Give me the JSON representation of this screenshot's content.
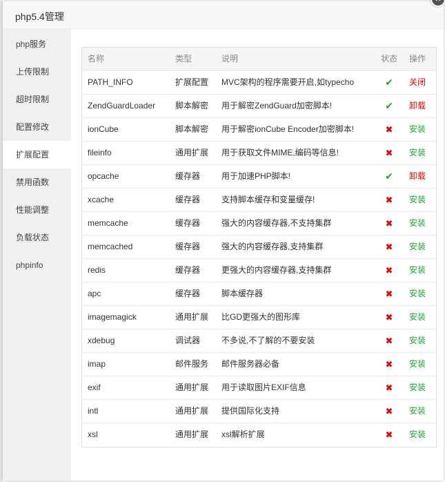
{
  "dialog": {
    "title": "php5.4管理",
    "close_icon": "×"
  },
  "sidebar": {
    "items": [
      {
        "label": "php服务"
      },
      {
        "label": "上传限制"
      },
      {
        "label": "超时限制"
      },
      {
        "label": "配置修改"
      },
      {
        "label": "扩展配置",
        "active": true
      },
      {
        "label": "禁用函数"
      },
      {
        "label": "性能调整"
      },
      {
        "label": "负载状态"
      },
      {
        "label": "phpinfo"
      }
    ]
  },
  "table": {
    "headers": {
      "name": "名称",
      "type": "类型",
      "desc": "说明",
      "status": "状态",
      "op": "操作"
    },
    "rows": [
      {
        "name": "PATH_INFO",
        "type": "扩展配置",
        "desc": "MVC架构的程序需要开启,如typecho",
        "status": "✔",
        "op": "关闭"
      },
      {
        "name": "ZendGuardLoader",
        "type": "脚本解密",
        "desc": "用于解密ZendGuard加密脚本!",
        "status": "✔",
        "op": "卸载"
      },
      {
        "name": "ionCube",
        "type": "脚本解密",
        "desc": "用于解密ionCube Encoder加密脚本!",
        "status": "✖",
        "op": "安装"
      },
      {
        "name": "fileinfo",
        "type": "通用扩展",
        "desc": "用于获取文件MIME,编码等信息!",
        "status": "✖",
        "op": "安装"
      },
      {
        "name": "opcache",
        "type": "缓存器",
        "desc": "用于加速PHP脚本!",
        "status": "✔",
        "op": "卸载"
      },
      {
        "name": "xcache",
        "type": "缓存器",
        "desc": "支持脚本缓存和变量缓存!",
        "status": "✖",
        "op": "安装"
      },
      {
        "name": "memcache",
        "type": "缓存器",
        "desc": "强大的内容缓存器,不支持集群",
        "status": "✖",
        "op": "安装"
      },
      {
        "name": "memcached",
        "type": "缓存器",
        "desc": "强大的内容缓存器,支持集群",
        "status": "✖",
        "op": "安装"
      },
      {
        "name": "redis",
        "type": "缓存器",
        "desc": "更强大的内容缓存器,支持集群",
        "status": "✖",
        "op": "安装"
      },
      {
        "name": "apc",
        "type": "缓存器",
        "desc": "脚本缓存器",
        "status": "✖",
        "op": "安装"
      },
      {
        "name": "imagemagick",
        "type": "通用扩展",
        "desc": "比GD更强大的图形库",
        "status": "✖",
        "op": "安装"
      },
      {
        "name": "xdebug",
        "type": "调试器",
        "desc": "不多说,不了解的不要安装",
        "status": "✖",
        "op": "安装"
      },
      {
        "name": "imap",
        "type": "邮件服务",
        "desc": "邮件服务器必备",
        "status": "✖",
        "op": "安装"
      },
      {
        "name": "exif",
        "type": "通用扩展",
        "desc": "用于读取图片EXIF信息",
        "status": "✖",
        "op": "安装"
      },
      {
        "name": "intl",
        "type": "通用扩展",
        "desc": "提供国际化支持",
        "status": "✖",
        "op": "安装"
      },
      {
        "name": "xsl",
        "type": "通用扩展",
        "desc": "xsl解析扩展",
        "status": "✖",
        "op": "安装"
      }
    ]
  },
  "colors": {
    "installed": "#20a53a",
    "not_installed": "#ee0000",
    "uninstall_action": "#ee0000",
    "install_action": "#20a53a"
  }
}
